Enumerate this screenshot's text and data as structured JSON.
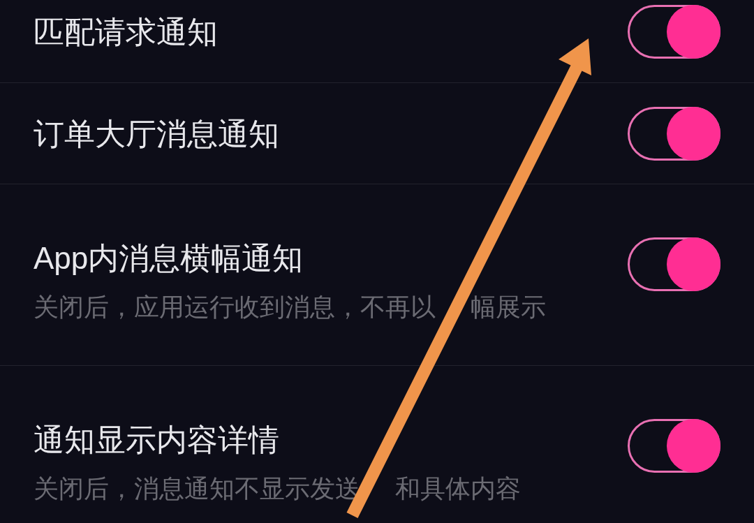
{
  "settings": [
    {
      "title": "匹配请求通知",
      "on": true
    },
    {
      "title": "订单大厅消息通知",
      "on": true
    },
    {
      "title": "App内消息横幅通知",
      "description": [
        "关闭后，应用运行收到消息，不再以",
        "幅展示"
      ],
      "on": true
    },
    {
      "title": "通知显示内容详情",
      "description": [
        "关闭后，消息通知不显示发送",
        "和具体内容"
      ],
      "on": true
    }
  ]
}
